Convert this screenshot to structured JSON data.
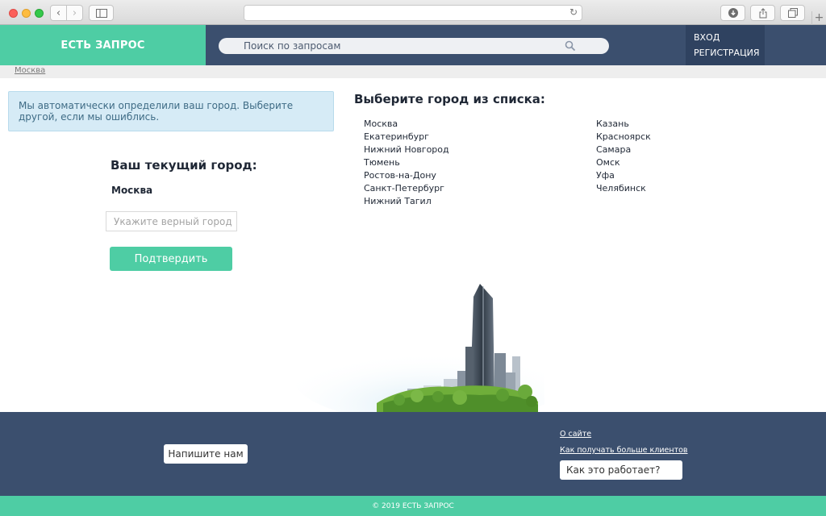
{
  "browser": {
    "url": "",
    "icons": {
      "back": "chevron-left-icon",
      "forward": "chevron-right-icon",
      "sidebar": "sidebar-icon",
      "reload": "reload-icon",
      "download": "download-icon",
      "share": "share-icon",
      "tabs": "tabs-icon",
      "new_tab": "plus-icon"
    }
  },
  "header": {
    "logo": "ЕСТЬ ЗАПРОС",
    "search_placeholder": "Поиск по запросам",
    "login": "ВХОД",
    "register": "РЕГИСТРАЦИЯ"
  },
  "breadcrumb": "Москва",
  "left": {
    "alert": "Мы автоматически определили ваш город. Выберите другой, если мы ошиблись.",
    "current_title": "Ваш текущий город:",
    "current_city": "Москва",
    "input_placeholder": "Укажите верный город",
    "confirm": "Подтвердить"
  },
  "right": {
    "title": "Выберите город из списка:",
    "col1": [
      "Москва",
      "Екатеринбург",
      "Нижний Новгород",
      "Тюмень",
      "Ростов-на-Дону",
      "Санкт-Петербург",
      "Нижний Тагил"
    ],
    "col2": [
      "Казань",
      "Красноярск",
      "Самара",
      "Омск",
      "Уфа",
      "Челябинск"
    ]
  },
  "footer": {
    "write_us": "Напишите нам",
    "about": "О сайте",
    "more_clients": "Как получать больше клиентов",
    "how_it_works": "Как это работает?",
    "copyright": "© 2019 ЕСТЬ ЗАПРОС"
  },
  "colors": {
    "brand_green": "#4ecda4",
    "navy": "#3b4f6e",
    "auth_bg": "#2f4260",
    "alert_bg": "#d6ebf6"
  }
}
